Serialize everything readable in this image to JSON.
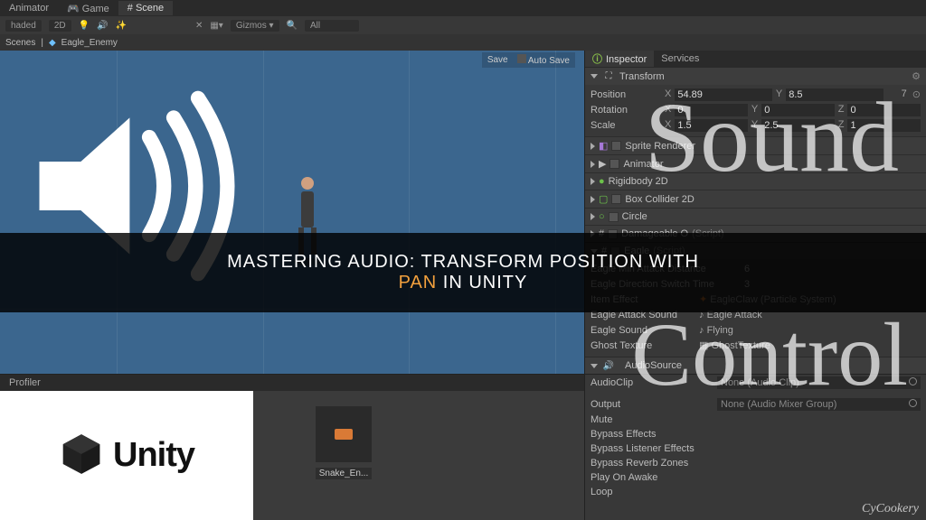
{
  "overlay": {
    "line1_a": "MASTERING AUDIO: TRANSFORM POSITION WITH",
    "line2_highlight": "PAN",
    "line2_rest": " IN UNITY"
  },
  "decor": {
    "sound": "Sound",
    "control": "Control"
  },
  "watermark": "CyCookery",
  "tabs": {
    "animator": "Animator",
    "game": "Game",
    "scene": "Scene"
  },
  "toolbar": {
    "shaded": "haded",
    "twoD": "2D",
    "gizmos": "Gizmos",
    "search": "All"
  },
  "breadcrumb": {
    "scenes": "Scenes",
    "object": "Eagle_Enemy"
  },
  "scene": {
    "save": "Save",
    "autosave": "Auto Save"
  },
  "inspector": {
    "tab_inspector": "Inspector",
    "tab_services": "Services",
    "transform": {
      "title": "Transform",
      "position": {
        "label": "Position",
        "x": "54.89",
        "y": "8.5",
        "z": "7"
      },
      "rotation": {
        "label": "Rotation",
        "x": "0",
        "y": "0",
        "z": "0"
      },
      "scale": {
        "label": "Scale",
        "x": "1.5",
        "y": "2.5",
        "z": "1"
      }
    },
    "components": [
      "Sprite Renderer",
      "Animator",
      "Rigidbody 2D",
      "Box Collider 2D",
      "Circle",
      "Damageable O",
      "Eagle"
    ],
    "props": {
      "min_attack": {
        "label": "Eagle Min Attack Distance",
        "value": "6"
      },
      "switch_time": {
        "label": "Eagle Direction Switch Time",
        "value": "3"
      },
      "item_effect": {
        "label": "Item Effect",
        "value": "EagleClaw (Particle System)"
      },
      "attack_sound": {
        "label": "Eagle Attack Sound",
        "value": "Eagle Attack"
      },
      "eagle_sound": {
        "label": "Eagle Sound",
        "value": "Flying"
      },
      "ghost_texture": {
        "label": "Ghost Texture",
        "value": "GhostTexture"
      }
    },
    "audio": {
      "title": "AudioSource",
      "clip": {
        "label": "AudioClip",
        "value": "None (Audio Clip)"
      },
      "output": {
        "label": "Output",
        "value": "None (Audio Mixer Group)"
      },
      "mute": "Mute",
      "bypass_effects": "Bypass Effects",
      "bypass_listener": "Bypass Listener Effects",
      "bypass_reverb": "Bypass Reverb Zones",
      "play_awake": "Play On Awake",
      "loop": "Loop"
    }
  },
  "bottom": {
    "tab_profiler": "Profiler",
    "unity": "Unity",
    "asset_name": "Snake_En..."
  }
}
